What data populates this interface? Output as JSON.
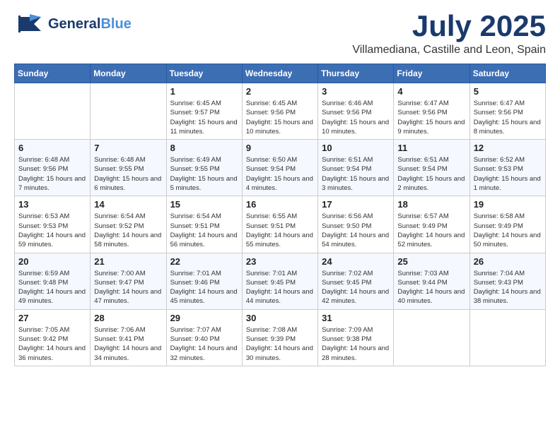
{
  "header": {
    "logo_general": "General",
    "logo_blue": "Blue",
    "month": "July 2025",
    "location": "Villamediana, Castille and Leon, Spain"
  },
  "days_of_week": [
    "Sunday",
    "Monday",
    "Tuesday",
    "Wednesday",
    "Thursday",
    "Friday",
    "Saturday"
  ],
  "weeks": [
    [
      {
        "day": "",
        "sunrise": "",
        "sunset": "",
        "daylight": ""
      },
      {
        "day": "",
        "sunrise": "",
        "sunset": "",
        "daylight": ""
      },
      {
        "day": "1",
        "sunrise": "Sunrise: 6:45 AM",
        "sunset": "Sunset: 9:57 PM",
        "daylight": "Daylight: 15 hours and 11 minutes."
      },
      {
        "day": "2",
        "sunrise": "Sunrise: 6:45 AM",
        "sunset": "Sunset: 9:56 PM",
        "daylight": "Daylight: 15 hours and 10 minutes."
      },
      {
        "day": "3",
        "sunrise": "Sunrise: 6:46 AM",
        "sunset": "Sunset: 9:56 PM",
        "daylight": "Daylight: 15 hours and 10 minutes."
      },
      {
        "day": "4",
        "sunrise": "Sunrise: 6:47 AM",
        "sunset": "Sunset: 9:56 PM",
        "daylight": "Daylight: 15 hours and 9 minutes."
      },
      {
        "day": "5",
        "sunrise": "Sunrise: 6:47 AM",
        "sunset": "Sunset: 9:56 PM",
        "daylight": "Daylight: 15 hours and 8 minutes."
      }
    ],
    [
      {
        "day": "6",
        "sunrise": "Sunrise: 6:48 AM",
        "sunset": "Sunset: 9:56 PM",
        "daylight": "Daylight: 15 hours and 7 minutes."
      },
      {
        "day": "7",
        "sunrise": "Sunrise: 6:48 AM",
        "sunset": "Sunset: 9:55 PM",
        "daylight": "Daylight: 15 hours and 6 minutes."
      },
      {
        "day": "8",
        "sunrise": "Sunrise: 6:49 AM",
        "sunset": "Sunset: 9:55 PM",
        "daylight": "Daylight: 15 hours and 5 minutes."
      },
      {
        "day": "9",
        "sunrise": "Sunrise: 6:50 AM",
        "sunset": "Sunset: 9:54 PM",
        "daylight": "Daylight: 15 hours and 4 minutes."
      },
      {
        "day": "10",
        "sunrise": "Sunrise: 6:51 AM",
        "sunset": "Sunset: 9:54 PM",
        "daylight": "Daylight: 15 hours and 3 minutes."
      },
      {
        "day": "11",
        "sunrise": "Sunrise: 6:51 AM",
        "sunset": "Sunset: 9:54 PM",
        "daylight": "Daylight: 15 hours and 2 minutes."
      },
      {
        "day": "12",
        "sunrise": "Sunrise: 6:52 AM",
        "sunset": "Sunset: 9:53 PM",
        "daylight": "Daylight: 15 hours and 1 minute."
      }
    ],
    [
      {
        "day": "13",
        "sunrise": "Sunrise: 6:53 AM",
        "sunset": "Sunset: 9:53 PM",
        "daylight": "Daylight: 14 hours and 59 minutes."
      },
      {
        "day": "14",
        "sunrise": "Sunrise: 6:54 AM",
        "sunset": "Sunset: 9:52 PM",
        "daylight": "Daylight: 14 hours and 58 minutes."
      },
      {
        "day": "15",
        "sunrise": "Sunrise: 6:54 AM",
        "sunset": "Sunset: 9:51 PM",
        "daylight": "Daylight: 14 hours and 56 minutes."
      },
      {
        "day": "16",
        "sunrise": "Sunrise: 6:55 AM",
        "sunset": "Sunset: 9:51 PM",
        "daylight": "Daylight: 14 hours and 55 minutes."
      },
      {
        "day": "17",
        "sunrise": "Sunrise: 6:56 AM",
        "sunset": "Sunset: 9:50 PM",
        "daylight": "Daylight: 14 hours and 54 minutes."
      },
      {
        "day": "18",
        "sunrise": "Sunrise: 6:57 AM",
        "sunset": "Sunset: 9:49 PM",
        "daylight": "Daylight: 14 hours and 52 minutes."
      },
      {
        "day": "19",
        "sunrise": "Sunrise: 6:58 AM",
        "sunset": "Sunset: 9:49 PM",
        "daylight": "Daylight: 14 hours and 50 minutes."
      }
    ],
    [
      {
        "day": "20",
        "sunrise": "Sunrise: 6:59 AM",
        "sunset": "Sunset: 9:48 PM",
        "daylight": "Daylight: 14 hours and 49 minutes."
      },
      {
        "day": "21",
        "sunrise": "Sunrise: 7:00 AM",
        "sunset": "Sunset: 9:47 PM",
        "daylight": "Daylight: 14 hours and 47 minutes."
      },
      {
        "day": "22",
        "sunrise": "Sunrise: 7:01 AM",
        "sunset": "Sunset: 9:46 PM",
        "daylight": "Daylight: 14 hours and 45 minutes."
      },
      {
        "day": "23",
        "sunrise": "Sunrise: 7:01 AM",
        "sunset": "Sunset: 9:45 PM",
        "daylight": "Daylight: 14 hours and 44 minutes."
      },
      {
        "day": "24",
        "sunrise": "Sunrise: 7:02 AM",
        "sunset": "Sunset: 9:45 PM",
        "daylight": "Daylight: 14 hours and 42 minutes."
      },
      {
        "day": "25",
        "sunrise": "Sunrise: 7:03 AM",
        "sunset": "Sunset: 9:44 PM",
        "daylight": "Daylight: 14 hours and 40 minutes."
      },
      {
        "day": "26",
        "sunrise": "Sunrise: 7:04 AM",
        "sunset": "Sunset: 9:43 PM",
        "daylight": "Daylight: 14 hours and 38 minutes."
      }
    ],
    [
      {
        "day": "27",
        "sunrise": "Sunrise: 7:05 AM",
        "sunset": "Sunset: 9:42 PM",
        "daylight": "Daylight: 14 hours and 36 minutes."
      },
      {
        "day": "28",
        "sunrise": "Sunrise: 7:06 AM",
        "sunset": "Sunset: 9:41 PM",
        "daylight": "Daylight: 14 hours and 34 minutes."
      },
      {
        "day": "29",
        "sunrise": "Sunrise: 7:07 AM",
        "sunset": "Sunset: 9:40 PM",
        "daylight": "Daylight: 14 hours and 32 minutes."
      },
      {
        "day": "30",
        "sunrise": "Sunrise: 7:08 AM",
        "sunset": "Sunset: 9:39 PM",
        "daylight": "Daylight: 14 hours and 30 minutes."
      },
      {
        "day": "31",
        "sunrise": "Sunrise: 7:09 AM",
        "sunset": "Sunset: 9:38 PM",
        "daylight": "Daylight: 14 hours and 28 minutes."
      },
      {
        "day": "",
        "sunrise": "",
        "sunset": "",
        "daylight": ""
      },
      {
        "day": "",
        "sunrise": "",
        "sunset": "",
        "daylight": ""
      }
    ]
  ]
}
